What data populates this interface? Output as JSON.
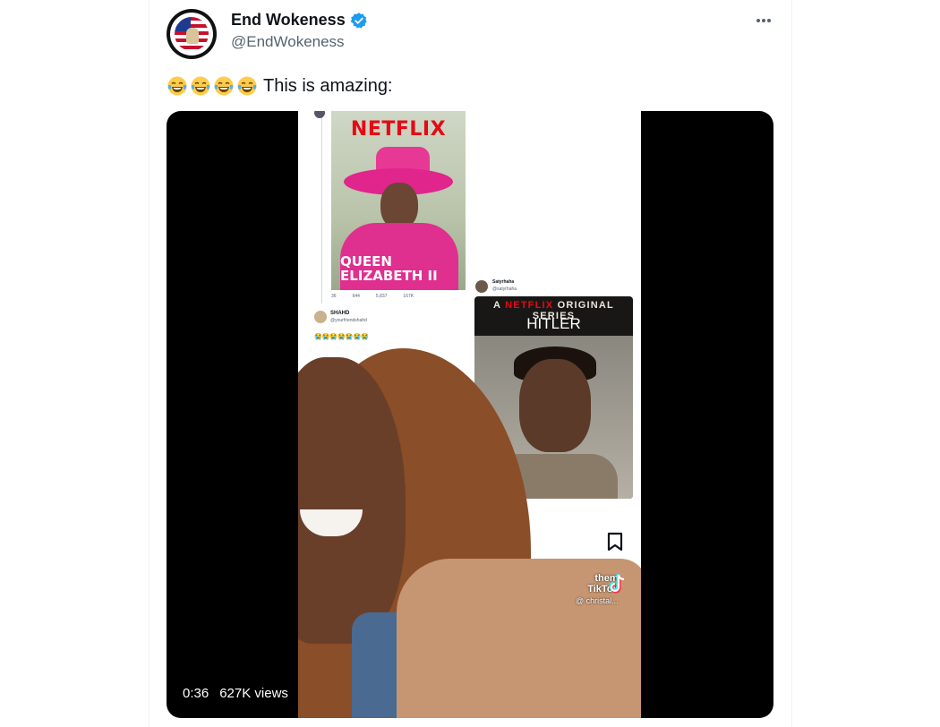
{
  "tweet": {
    "display_name": "End Wokeness",
    "handle": "@EndWokeness",
    "text": "This is amazing:",
    "emoji_count": 4,
    "emoji_name": "face-with-tears-of-joy-icon",
    "verified_color": "#1d9bf0"
  },
  "video": {
    "duration": "0:36",
    "views": "627K views",
    "content": {
      "poster1": {
        "brand": "NETFLIX",
        "title_line1": "QUEEN",
        "title_line2": "ELIZABETH II",
        "stats": [
          "36",
          "644",
          "5,837",
          "167K"
        ]
      },
      "reply": {
        "name": "SHAHD",
        "handle": "@yourfriendshahd",
        "emojis": "😭😭😭😭😭😭😭"
      },
      "satyr": {
        "name": "Satyrhaha",
        "handle": "@satyrhaha"
      },
      "poster2": {
        "series_prefix": "A",
        "series_brand": "NETFLIX",
        "series_suffix": "ORIGINAL SERIES",
        "title": "HITLER"
      },
      "tiktok": {
        "caption": "them",
        "brand": "TikTok",
        "username": "@ christal..."
      }
    }
  },
  "colors": {
    "netflix_red": "#e50914",
    "secondary_text": "#536471",
    "media_bg": "#000000"
  }
}
